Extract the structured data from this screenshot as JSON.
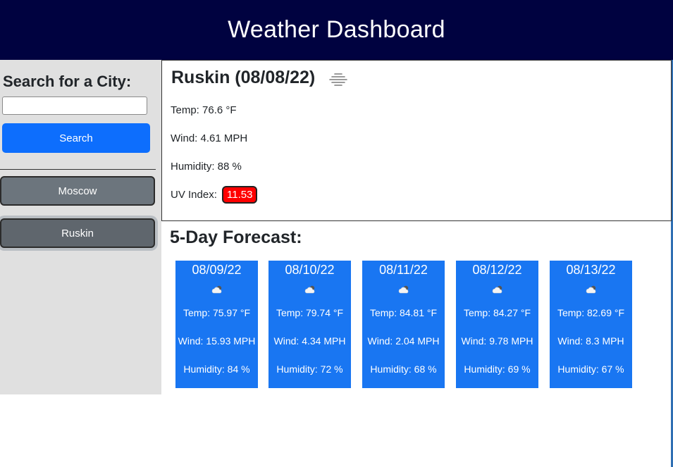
{
  "header": {
    "title": "Weather Dashboard"
  },
  "sidebar": {
    "search_title": "Search for a City:",
    "search_value": "",
    "search_button": "Search",
    "history": [
      "Moscow",
      "Ruskin"
    ]
  },
  "current": {
    "title": "Ruskin (08/08/22)",
    "icon": "fog-icon",
    "temp": "Temp: 76.6 °F",
    "wind": "Wind: 4.61 MPH",
    "humidity": "Humidity: 88 %",
    "uv_label": "UV Index:",
    "uv_value": "11.53",
    "uv_color": "#ff0000"
  },
  "forecast": {
    "title": "5-Day Forecast:",
    "days": [
      {
        "date": "08/09/22",
        "icon": "cloud-icon",
        "temp": "Temp: 75.97 °F",
        "wind": "Wind: 15.93 MPH",
        "humidity": "Humidity: 84 %"
      },
      {
        "date": "08/10/22",
        "icon": "cloud-icon",
        "temp": "Temp: 79.74 °F",
        "wind": "Wind: 4.34 MPH",
        "humidity": "Humidity: 72 %"
      },
      {
        "date": "08/11/22",
        "icon": "cloud-icon",
        "temp": "Temp: 84.81 °F",
        "wind": "Wind: 2.04 MPH",
        "humidity": "Humidity: 68 %"
      },
      {
        "date": "08/12/22",
        "icon": "cloud-icon",
        "temp": "Temp: 84.27 °F",
        "wind": "Wind: 9.78 MPH",
        "humidity": "Humidity: 69 %"
      },
      {
        "date": "08/13/22",
        "icon": "cloud-icon",
        "temp": "Temp: 82.69 °F",
        "wind": "Wind: 8.3 MPH",
        "humidity": "Humidity: 67 %"
      }
    ]
  },
  "colors": {
    "header_bg": "#000240",
    "accent": "#0d6efd",
    "card_bg": "#1976f2",
    "history_btn": "#6c757d"
  }
}
